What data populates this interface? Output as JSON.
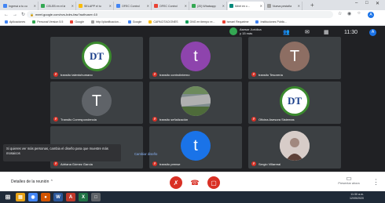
{
  "browser": {
    "tabs": [
      {
        "label": "Ingresá a tu cu",
        "color": "#4285f4"
      },
      {
        "label": "CELEB en el la",
        "color": "#34a853"
      },
      {
        "label": "SELAPP el tu",
        "color": "#fbbc05"
      },
      {
        "label": "OFEC Control",
        "color": "#4285f4"
      },
      {
        "label": "OFEC Control",
        "color": "#ea4335"
      },
      {
        "label": "(20) Whatsapp",
        "color": "#34a853"
      },
      {
        "label": "Meet en c...",
        "color": "#00897b"
      },
      {
        "label": "Nueva pestaña",
        "color": "#9e9e9e"
      }
    ],
    "new_tab": "+",
    "url": "meet.google.com/xvs-bdrs-faw?authuser=10",
    "bookmarks": [
      {
        "label": "Aplicaciones",
        "color": "#4285f4"
      },
      {
        "label": "Personal Version 5.5",
        "color": "#34a853"
      },
      {
        "label": "Google",
        "color": "#ea4335"
      },
      {
        "label": "http://planificacion...",
        "color": "#9e9e9e"
      },
      {
        "label": "Google",
        "color": "#4285f4"
      },
      {
        "label": "CAPACITACIONES",
        "color": "#fbbc05"
      },
      {
        "label": "DNG en tiempo re...",
        "color": "#0f9d58"
      },
      {
        "label": "Ismael Requelme",
        "color": "#ea4335"
      },
      {
        "label": "Instituciones Públic...",
        "color": "#4285f4"
      }
    ],
    "profile_initial": "A"
  },
  "meet": {
    "presenter": {
      "line1": "Asesor Jurídica",
      "line2": "y 15 más"
    },
    "time": "11:30",
    "self_initial": "A",
    "tiles": [
      {
        "name": "transito talentohumano",
        "avatar": "logo",
        "letter": "DT"
      },
      {
        "name": "transito controlinterno",
        "avatar": "letter-purple",
        "letter": "t"
      },
      {
        "name": "transito Tesorería",
        "avatar": "letter-brown",
        "letter": "T"
      },
      {
        "name": "Transito Correspondencia",
        "avatar": "letter-grey",
        "letter": "T"
      },
      {
        "name": "transito señalización",
        "avatar": "photo",
        "letter": ""
      },
      {
        "name": "Oficina Asesora Sistemas",
        "avatar": "logo",
        "letter": "DT"
      },
      {
        "name": "Adriana Gómez García",
        "avatar": "none",
        "letter": ""
      },
      {
        "name": "transito prense",
        "avatar": "letter-blue",
        "letter": "t"
      },
      {
        "name": "Sergio Villarreal",
        "avatar": "person",
        "letter": ""
      }
    ],
    "snackbar": {
      "message": "Si quieres ver más personas, cambia el diseño para que muestre más mosaicos",
      "action": "Cambiar diseño"
    }
  },
  "controls": {
    "details": "Detalles de la reunión",
    "present_label": "Presentar ahora"
  },
  "taskbar": {
    "time": "11:30 a.m.",
    "date": "12/05/2020"
  }
}
